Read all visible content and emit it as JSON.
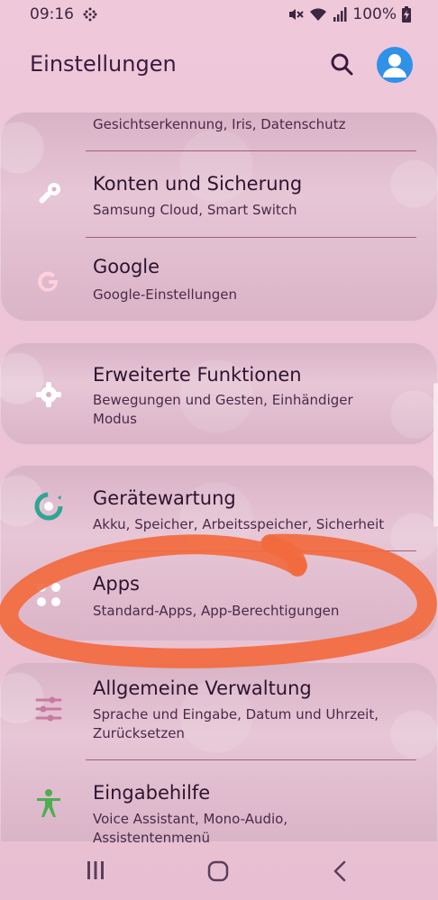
{
  "status": {
    "time": "09:16",
    "battery": "100%"
  },
  "header": {
    "title": "Einstellungen"
  },
  "settings": [
    {
      "title": "",
      "subtitle": "Gesichtserkennung, Iris, Datenschutz"
    },
    {
      "title": "Konten und Sicherung",
      "subtitle": "Samsung Cloud, Smart Switch",
      "icon": "key-icon"
    },
    {
      "title": "Google",
      "subtitle": "Google-Einstellungen",
      "icon": "google-icon"
    },
    {
      "title": "Erweiterte Funktionen",
      "subtitle": "Bewegungen und Gesten, Einhändiger Modus",
      "icon": "puzzle-gear-icon"
    },
    {
      "title": "Gerätewartung",
      "subtitle": "Akku, Speicher, Arbeitsspeicher, Sicherheit",
      "icon": "device-care-icon"
    },
    {
      "title": "Apps",
      "subtitle": "Standard-Apps, App-Berechtigungen",
      "icon": "apps-grid-icon"
    },
    {
      "title": "Allgemeine Verwaltung",
      "subtitle": "Sprache und Eingabe, Datum und Uhrzeit, Zurücksetzen",
      "icon": "sliders-icon"
    },
    {
      "title": "Eingabehilfe",
      "subtitle": "Voice Assistant, Mono-Audio, Assistentenmenü",
      "icon": "accessibility-icon"
    }
  ],
  "colors": {
    "annotation": "#f26a3e",
    "accent_blue": "#2f91e8",
    "teal": "#2fa592",
    "green": "#4caf50"
  }
}
